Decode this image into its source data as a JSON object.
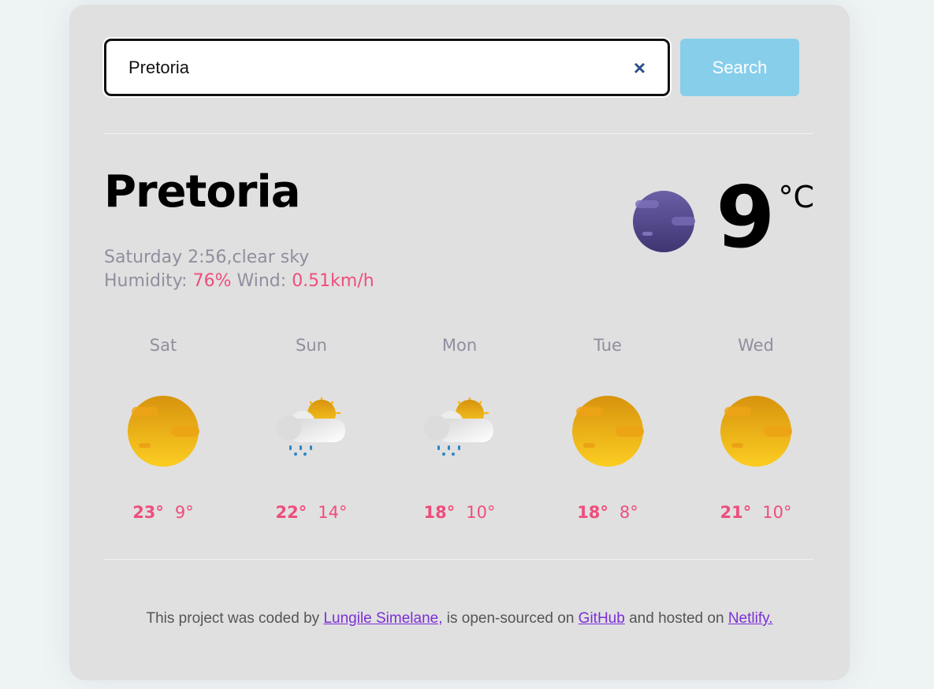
{
  "search": {
    "value": "Pretoria",
    "button_label": "Search",
    "clear_icon": "×"
  },
  "current": {
    "city": "Pretoria",
    "day_time": "Saturday 2:56",
    "description": "clear sky",
    "humidity_label": "Humidity:",
    "humidity_value": "76%",
    "wind_label": "Wind:",
    "wind_value": "0.51km/h",
    "temperature": "9",
    "unit": "°C",
    "icon": "clear-night-icon"
  },
  "forecast": [
    {
      "day": "Sat",
      "icon": "clear-day-icon",
      "max": "23°",
      "min": "9°"
    },
    {
      "day": "Sun",
      "icon": "rain-partly-cloudy-icon",
      "max": "22°",
      "min": "14°"
    },
    {
      "day": "Mon",
      "icon": "rain-partly-cloudy-icon",
      "max": "18°",
      "min": "10°"
    },
    {
      "day": "Tue",
      "icon": "clear-day-icon",
      "max": "18°",
      "min": "8°"
    },
    {
      "day": "Wed",
      "icon": "clear-day-icon",
      "max": "21°",
      "min": "10°"
    }
  ],
  "footer": {
    "text1": "This project was coded by ",
    "author_link": "Lungile Simelane,",
    "text2": " is open-sourced on ",
    "github_link": "GitHub",
    "text3": " and hosted on ",
    "netlify_link": "Netlify."
  },
  "colors": {
    "accent": "#ee4e7c",
    "button": "#87ceeb",
    "card": "#e0e0e0",
    "muted_text": "#8f8f9e",
    "link": "#7b2fd6"
  }
}
